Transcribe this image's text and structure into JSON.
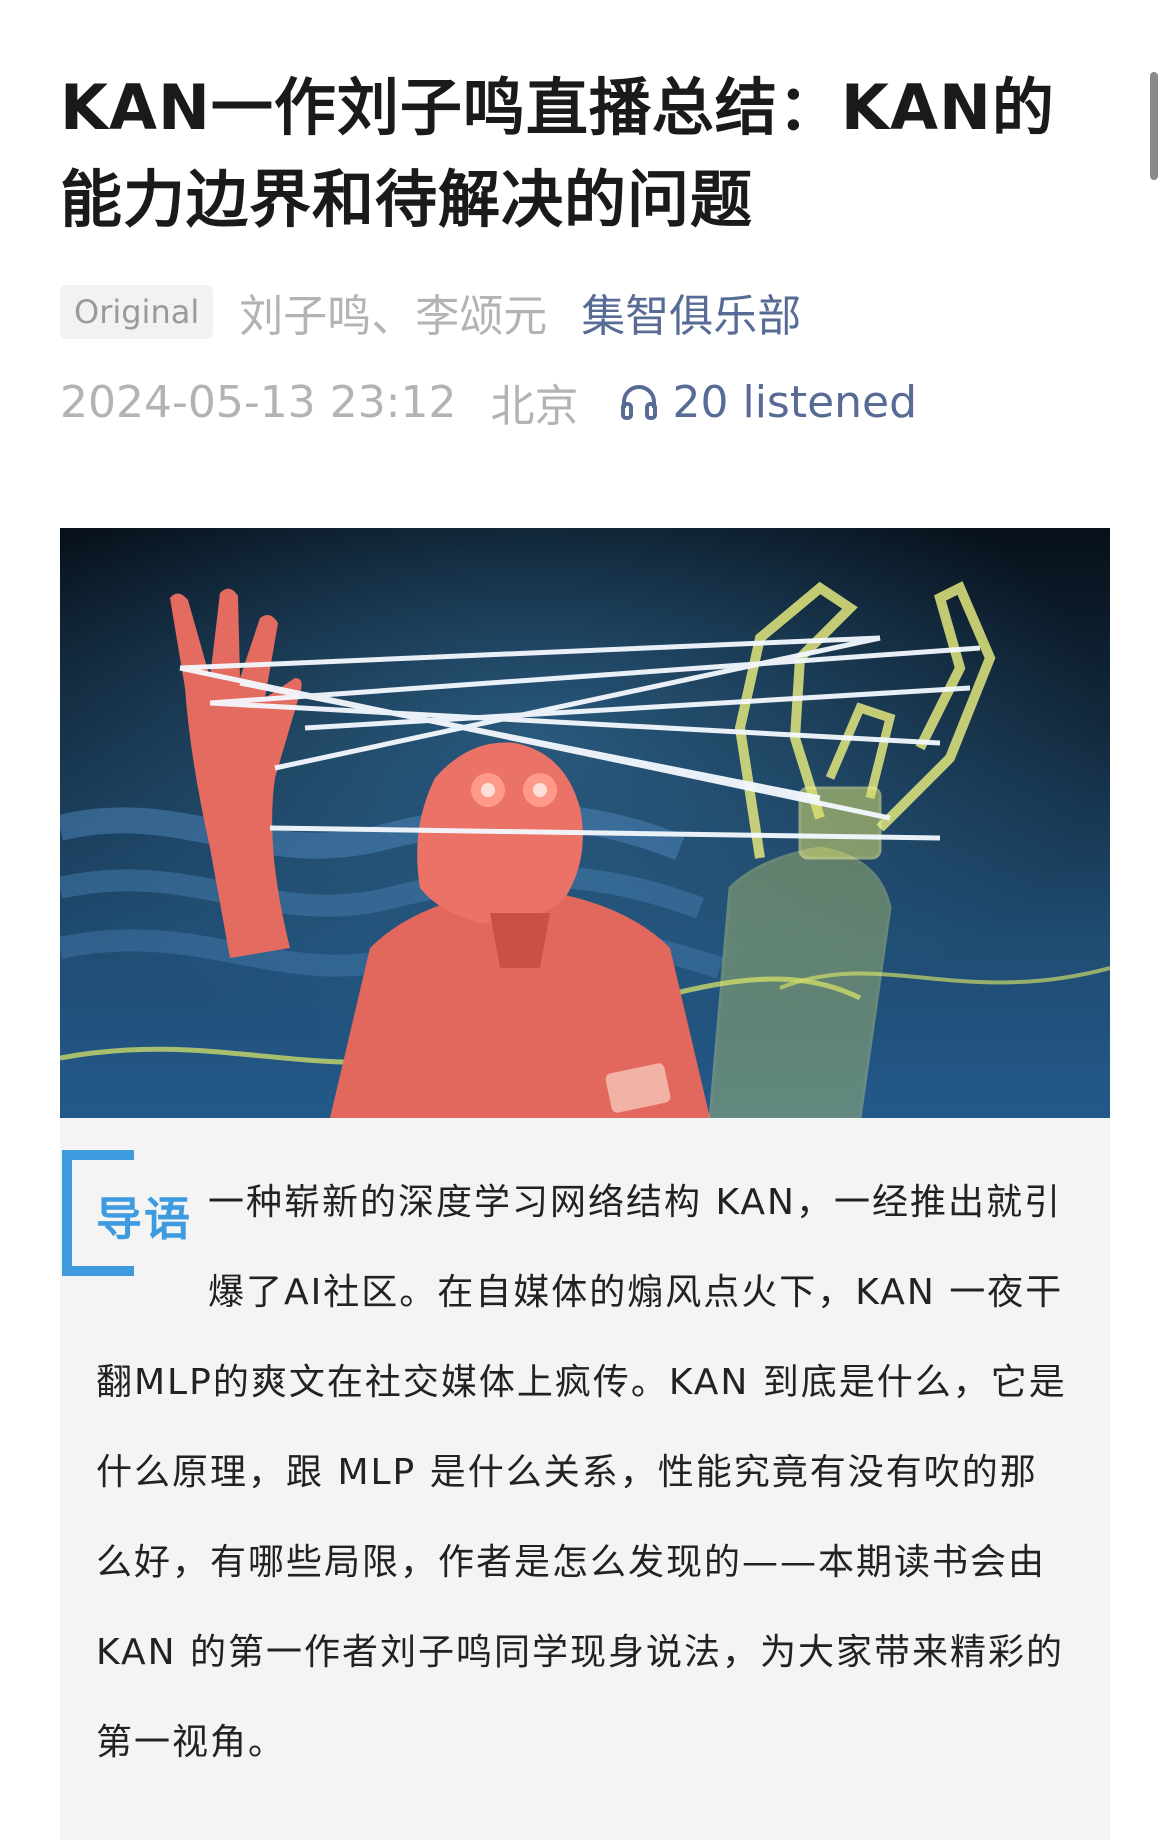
{
  "article": {
    "title": "KAN一作刘子鸣直播总结：KAN的能力边界和待解决的问题",
    "badge": "Original",
    "authors": "刘子鸣、李颂元",
    "account": "集智俱乐部",
    "date": "2024-05-13 23:12",
    "location": "北京",
    "listened": "20 listened",
    "listen_icon": "headphones-icon"
  },
  "intro": {
    "label": "导语",
    "text": "一种崭新的深度学习网络结构 KAN，一经推出就引爆了AI社区。在自媒体的煽风点火下，KAN 一夜干翻MLP的爽文在社交媒体上疯传。KAN 到底是什么，它是什么原理，跟 MLP 是什么关系，性能究竟有没有吹的那么好，有哪些局限，作者是怎么发现的——本期读书会由 KAN 的第一作者刘子鸣同学现身说法，为大家带来精彩的第一视角。"
  },
  "colors": {
    "link": "#576b95",
    "accent": "#3e9be0",
    "muted": "#b3b3b3"
  }
}
